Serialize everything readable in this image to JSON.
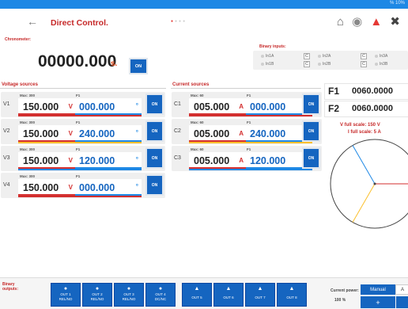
{
  "status": {
    "text": "% 10%"
  },
  "header": {
    "back_icon": "back-arrow-icon",
    "title": "Direct Control."
  },
  "icons": {
    "home": "home-icon",
    "settings": "settings-icon",
    "warning": "warning-icon",
    "tools": "tools-icon"
  },
  "chronometer": {
    "label": "Chronometer:",
    "value": "00000.000",
    "unit": "s.",
    "on_label": "ON"
  },
  "binary_inputs": {
    "title": "Binary inputs:",
    "items": [
      {
        "label": "In1A",
        "c": "C"
      },
      {
        "label": "In2A",
        "c": "C"
      },
      {
        "label": "In3A",
        "c": ""
      },
      {
        "label": "In1B",
        "c": "C"
      },
      {
        "label": "In2B",
        "c": "C"
      },
      {
        "label": "In3B",
        "c": ""
      }
    ]
  },
  "voltage": {
    "title": "Voltage sources",
    "rows": [
      {
        "label": "V1",
        "max": "Max: 300",
        "f1": "F1",
        "amplitude": "150.000",
        "unit": "V",
        "phase": "000.000",
        "phase_unit": "°",
        "on": "ON",
        "color": "#d32f2f"
      },
      {
        "label": "V2",
        "max": "Max: 300",
        "f1": "F1",
        "amplitude": "150.000",
        "unit": "V",
        "phase": "240.000",
        "phase_unit": "°",
        "on": "ON",
        "color": "#fbc02d"
      },
      {
        "label": "V3",
        "max": "Max: 300",
        "f1": "F1",
        "amplitude": "150.000",
        "unit": "V",
        "phase": "120.000",
        "phase_unit": "°",
        "on": "ON",
        "color": "#1e88e5"
      },
      {
        "label": "V4",
        "max": "Max: 300",
        "f1": "F1",
        "amplitude": "150.000",
        "unit": "V",
        "phase": "000.000",
        "phase_unit": "°",
        "on": "ON",
        "color": "#d32f2f"
      }
    ]
  },
  "current": {
    "title": "Current sources",
    "rows": [
      {
        "label": "C1",
        "max": "Max: 60",
        "f1": "F1",
        "amplitude": "005.000",
        "unit": "A",
        "phase": "000.000",
        "phase_unit": "°",
        "on": "ON",
        "color": "#d32f2f"
      },
      {
        "label": "C2",
        "max": "Max: 60",
        "f1": "F1",
        "amplitude": "005.000",
        "unit": "A",
        "phase": "240.000",
        "phase_unit": "°",
        "on": "ON",
        "color": "#fbc02d"
      },
      {
        "label": "C3",
        "max": "Max: 60",
        "f1": "F1",
        "amplitude": "005.000",
        "unit": "A",
        "phase": "120.000",
        "phase_unit": "°",
        "on": "ON",
        "color": "#1e88e5"
      }
    ]
  },
  "frequency": {
    "f1_label": "F1",
    "f1_value": "0060.0000",
    "f2_label": "F2",
    "f2_value": "0060.0000"
  },
  "fullscale": {
    "voltage": "V full scale: 150 V",
    "current": "I full scale: 5 A"
  },
  "phasor_angles": {
    "V1": 0,
    "V2": 240,
    "V3": 120
  },
  "binary_outputs": {
    "label_line1": "Binary",
    "label_line2": "outputs:",
    "items": [
      {
        "l1": "OUT 1",
        "l2": "REL/NO",
        "icon": "circle-icon"
      },
      {
        "l1": "OUT 2",
        "l2": "REL/NO",
        "icon": "circle-icon"
      },
      {
        "l1": "OUT 3",
        "l2": "REL/NO",
        "icon": "circle-icon"
      },
      {
        "l1": "OUT 4",
        "l2": "DC/NC",
        "icon": "circle-icon"
      },
      {
        "l1": "OUT 5",
        "l2": "",
        "icon": "triangle-icon"
      },
      {
        "l1": "OUT 6",
        "l2": "",
        "icon": "triangle-icon"
      },
      {
        "l1": "OUT 7",
        "l2": "",
        "icon": "triangle-icon"
      },
      {
        "l1": "OUT 8",
        "l2": "",
        "icon": "triangle-icon"
      }
    ]
  },
  "power": {
    "label": "Current power:",
    "value": "100 %",
    "manual": "Manual",
    "auto": "A",
    "plus": "+"
  }
}
